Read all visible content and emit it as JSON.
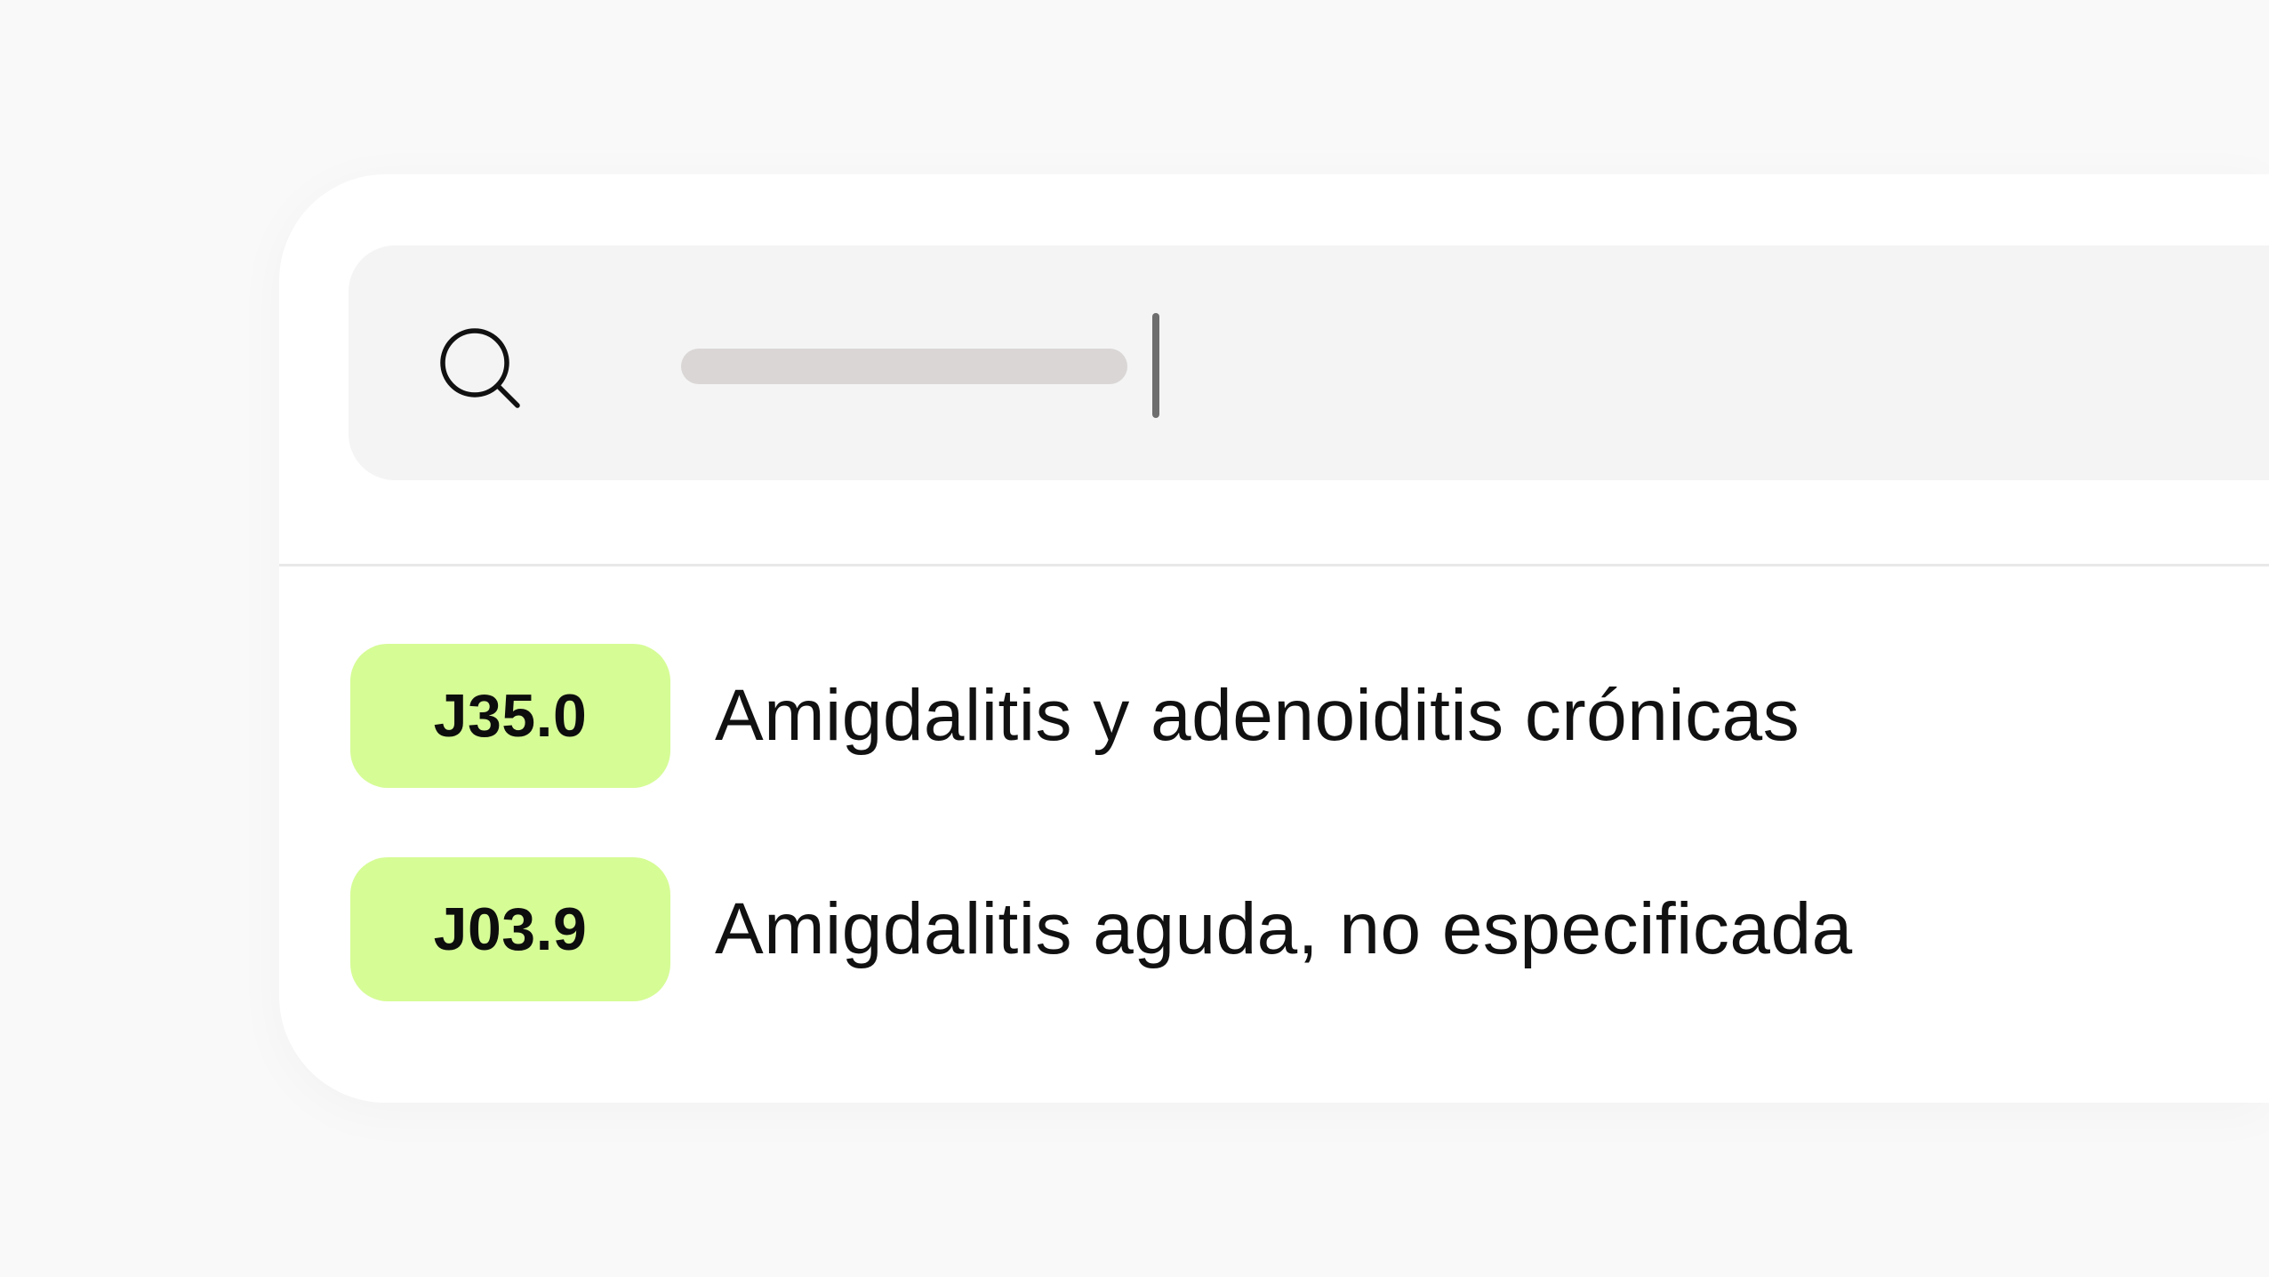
{
  "search": {
    "value": "",
    "placeholder": "",
    "icon": "search-icon"
  },
  "results": [
    {
      "code": "J35.0",
      "label": "Amigdalitis y adenoiditis crónicas"
    },
    {
      "code": "J03.9",
      "label": "Amigdalitis aguda, no especificada"
    }
  ],
  "colors": {
    "page_background": "#f9f9f9",
    "card_background": "#ffffff",
    "search_background": "#f4f4f4",
    "badge_background": "#d6fc96",
    "placeholder_bar": "#d9d6d5",
    "caret": "#6e6e6e",
    "text": "#111111"
  }
}
